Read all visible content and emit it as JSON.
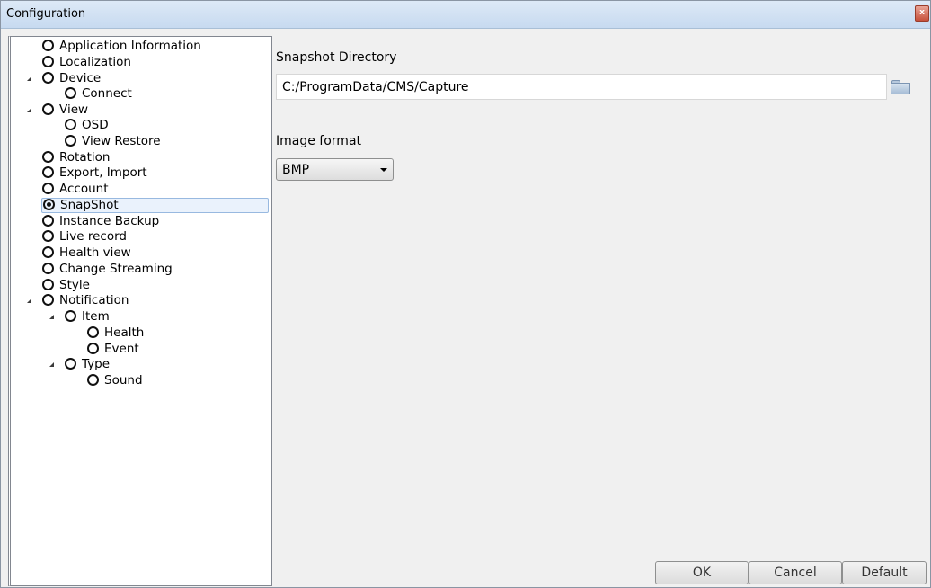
{
  "window": {
    "title": "Configuration",
    "close_label": "x"
  },
  "tree": {
    "items": [
      {
        "label": "Application Information",
        "checked": false
      },
      {
        "label": "Localization",
        "checked": false
      },
      {
        "label": "Device",
        "checked": false,
        "expanded": true
      },
      {
        "label": "Connect",
        "checked": false
      },
      {
        "label": "View",
        "checked": false,
        "expanded": true
      },
      {
        "label": "OSD",
        "checked": false
      },
      {
        "label": "View Restore",
        "checked": false
      },
      {
        "label": "Rotation",
        "checked": false
      },
      {
        "label": "Export, Import",
        "checked": false
      },
      {
        "label": "Account",
        "checked": false
      },
      {
        "label": "SnapShot",
        "checked": true,
        "selected": true
      },
      {
        "label": "Instance Backup",
        "checked": false
      },
      {
        "label": "Live record",
        "checked": false
      },
      {
        "label": "Health view",
        "checked": false
      },
      {
        "label": "Change Streaming",
        "checked": false
      },
      {
        "label": "Style",
        "checked": false
      },
      {
        "label": "Notification",
        "checked": false,
        "expanded": true
      },
      {
        "label": "Item",
        "checked": false,
        "expanded": true
      },
      {
        "label": "Health",
        "checked": false
      },
      {
        "label": "Event",
        "checked": false
      },
      {
        "label": "Type",
        "checked": false,
        "expanded": true
      },
      {
        "label": "Sound",
        "checked": false
      }
    ]
  },
  "snapshot": {
    "directory_label": "Snapshot Directory",
    "directory_value": "C:/ProgramData/CMS/Capture",
    "format_label": "Image format",
    "format_value": "BMP"
  },
  "buttons": {
    "ok": "OK",
    "cancel": "Cancel",
    "default": "Default"
  }
}
